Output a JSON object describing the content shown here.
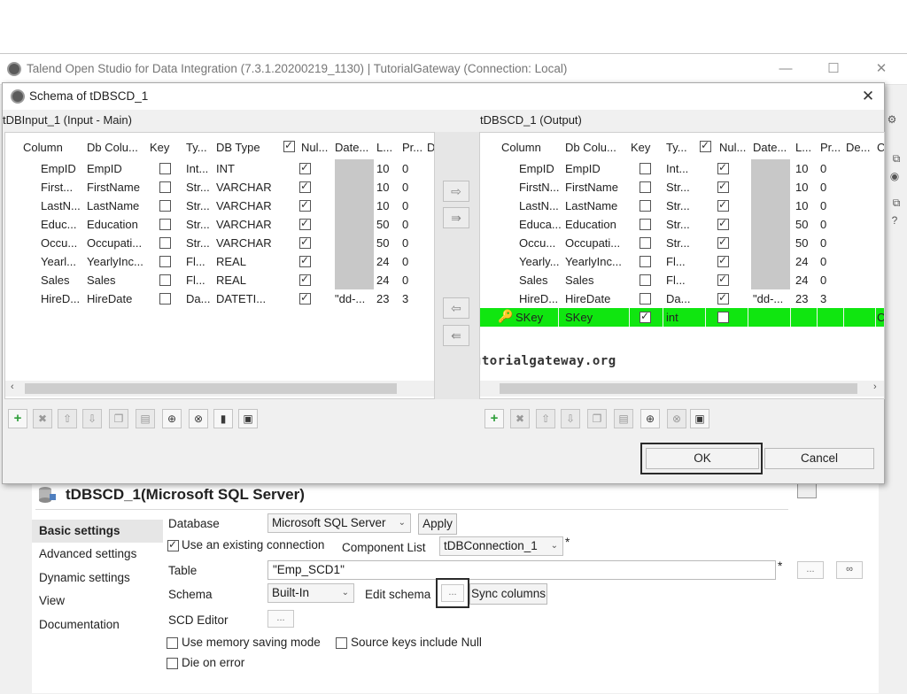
{
  "main_window": {
    "title": "Talend Open Studio for Data Integration (7.3.1.20200219_1130) | TutorialGateway (Connection: Local)",
    "controls": {
      "minimize": "—",
      "maximize": "☐",
      "close": "✕"
    }
  },
  "dialog": {
    "title": "Schema of tDBSCD_1",
    "close": "✕",
    "input_panel": {
      "title": "tDBInput_1 (Input - Main)",
      "columns": [
        "Column",
        "Db Colu...",
        "Key",
        "Ty...",
        "DB Type",
        "Nul...",
        "Date...",
        "L...",
        "Pr...",
        "D"
      ],
      "rows": [
        {
          "column": "EmpID",
          "db": "EmpID",
          "key": false,
          "type": "Int...",
          "dbtype": "INT",
          "nullable": true,
          "date": "",
          "length": "10",
          "precision": "0"
        },
        {
          "column": "First...",
          "db": "FirstName",
          "key": false,
          "type": "Str...",
          "dbtype": "VARCHAR",
          "nullable": true,
          "date": "",
          "length": "10",
          "precision": "0"
        },
        {
          "column": "LastN...",
          "db": "LastName",
          "key": false,
          "type": "Str...",
          "dbtype": "VARCHAR",
          "nullable": true,
          "date": "",
          "length": "10",
          "precision": "0"
        },
        {
          "column": "Educ...",
          "db": "Education",
          "key": false,
          "type": "Str...",
          "dbtype": "VARCHAR",
          "nullable": true,
          "date": "",
          "length": "50",
          "precision": "0"
        },
        {
          "column": "Occu...",
          "db": "Occupati...",
          "key": false,
          "type": "Str...",
          "dbtype": "VARCHAR",
          "nullable": true,
          "date": "",
          "length": "50",
          "precision": "0"
        },
        {
          "column": "Yearl...",
          "db": "YearlyInc...",
          "key": false,
          "type": "Fl...",
          "dbtype": "REAL",
          "nullable": true,
          "date": "",
          "length": "24",
          "precision": "0"
        },
        {
          "column": "Sales",
          "db": "Sales",
          "key": false,
          "type": "Fl...",
          "dbtype": "REAL",
          "nullable": true,
          "date": "",
          "length": "24",
          "precision": "0"
        },
        {
          "column": "HireD...",
          "db": "HireDate",
          "key": false,
          "type": "Da...",
          "dbtype": "DATETI...",
          "nullable": true,
          "date": "\"dd-...",
          "length": "23",
          "precision": "3"
        }
      ]
    },
    "output_panel": {
      "title": "tDBSCD_1 (Output)",
      "columns": [
        "Column",
        "Db Colu...",
        "Key",
        "Ty...",
        "Nul...",
        "Date...",
        "L...",
        "Pr...",
        "De...",
        "C"
      ],
      "rows": [
        {
          "column": "EmpID",
          "db": "EmpID",
          "key": false,
          "type": "Int...",
          "nullable": true,
          "date": "",
          "length": "10",
          "precision": "0"
        },
        {
          "column": "FirstN...",
          "db": "FirstName",
          "key": false,
          "type": "Str...",
          "nullable": true,
          "date": "",
          "length": "10",
          "precision": "0"
        },
        {
          "column": "LastN...",
          "db": "LastName",
          "key": false,
          "type": "Str...",
          "nullable": true,
          "date": "",
          "length": "10",
          "precision": "0"
        },
        {
          "column": "Educa...",
          "db": "Education",
          "key": false,
          "type": "Str...",
          "nullable": true,
          "date": "",
          "length": "50",
          "precision": "0"
        },
        {
          "column": "Occu...",
          "db": "Occupati...",
          "key": false,
          "type": "Str...",
          "nullable": true,
          "date": "",
          "length": "50",
          "precision": "0"
        },
        {
          "column": "Yearly...",
          "db": "YearlyInc...",
          "key": false,
          "type": "Fl...",
          "nullable": true,
          "date": "",
          "length": "24",
          "precision": "0"
        },
        {
          "column": "Sales",
          "db": "Sales",
          "key": false,
          "type": "Fl...",
          "nullable": true,
          "date": "",
          "length": "24",
          "precision": "0"
        },
        {
          "column": "HireD...",
          "db": "HireDate",
          "key": false,
          "type": "Da...",
          "nullable": true,
          "date": "\"dd-...",
          "length": "23",
          "precision": "3"
        },
        {
          "column": "SKey",
          "db": "SKey",
          "key": true,
          "type": "int",
          "nullable": false,
          "date": "",
          "length": "",
          "precision": "",
          "c": "C"
        }
      ],
      "highlight_color": "#10e610"
    },
    "watermark": "tutorialgateway.org",
    "ok_label": "OK",
    "cancel_label": "Cancel"
  },
  "component": {
    "title": "tDBSCD_1(Microsoft SQL Server)",
    "tabs": [
      "Basic settings",
      "Advanced settings",
      "Dynamic settings",
      "View",
      "Documentation"
    ],
    "active_tab": "Basic settings",
    "database_label": "Database",
    "database_value": "Microsoft SQL Server",
    "apply_label": "Apply",
    "use_existing_label": "Use an existing connection",
    "use_existing_checked": true,
    "component_list_label": "Component List",
    "component_list_value": "tDBConnection_1",
    "table_label": "Table",
    "table_value": "\"Emp_SCD1\"",
    "schema_label": "Schema",
    "schema_value": "Built-In",
    "edit_schema_label": "Edit schema",
    "sync_columns_label": "Sync columns",
    "scd_editor_label": "SCD Editor",
    "memory_saving_label": "Use memory saving mode",
    "source_keys_label": "Source keys include Null",
    "die_on_error_label": "Die on error",
    "required_mark": "*",
    "ellipsis": "..."
  },
  "colors": {
    "accent_green": "#10e610",
    "highlight_border": "#333333"
  }
}
